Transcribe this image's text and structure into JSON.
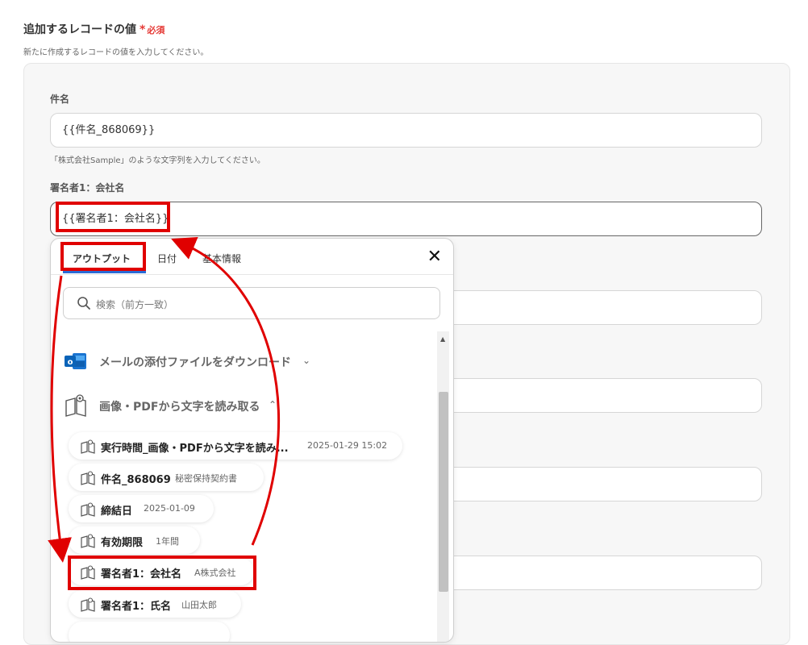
{
  "section": {
    "title": "追加するレコードの値",
    "required_mark": "*",
    "required_text": "必須",
    "description": "新たに作成するレコードの値を入力してください。"
  },
  "fields": [
    {
      "label": "件名",
      "value": "{{件名_868069}}",
      "hint": "「株式会社Sample」のような文字列を入力してください。"
    },
    {
      "label": "署名者1：会社名",
      "value": "{{署名者1：会社名}}"
    }
  ],
  "dropdown": {
    "tabs": [
      "アウトプット",
      "日付",
      "基本情報"
    ],
    "active_tab": "アウトプット",
    "close_icon": "close-icon",
    "search_placeholder": "検索（前方一致）",
    "groups": [
      {
        "label": "メールの添付ファイルをダウンロード",
        "icon": "outlook-icon",
        "expanded": false
      },
      {
        "label": "画像・PDFから文字を読み取る",
        "icon": "ocr-book-icon",
        "expanded": true
      }
    ],
    "items": [
      {
        "name": "実行時間_画像・PDFから文字を読み...",
        "value": "2025-01-29 15:02"
      },
      {
        "name": "件名_868069",
        "value": "秘密保持契約書"
      },
      {
        "name": "締結日",
        "value": "2025-01-09"
      },
      {
        "name": "有効期限",
        "value": "1年間"
      },
      {
        "name": "署名者1：会社名",
        "value": "A株式会社"
      },
      {
        "name": "署名者1：氏名",
        "value": "山田太郎"
      }
    ]
  },
  "colors": {
    "highlight": "#e00000",
    "required": "#e53935",
    "tab_underline": "#2a6bd6"
  }
}
